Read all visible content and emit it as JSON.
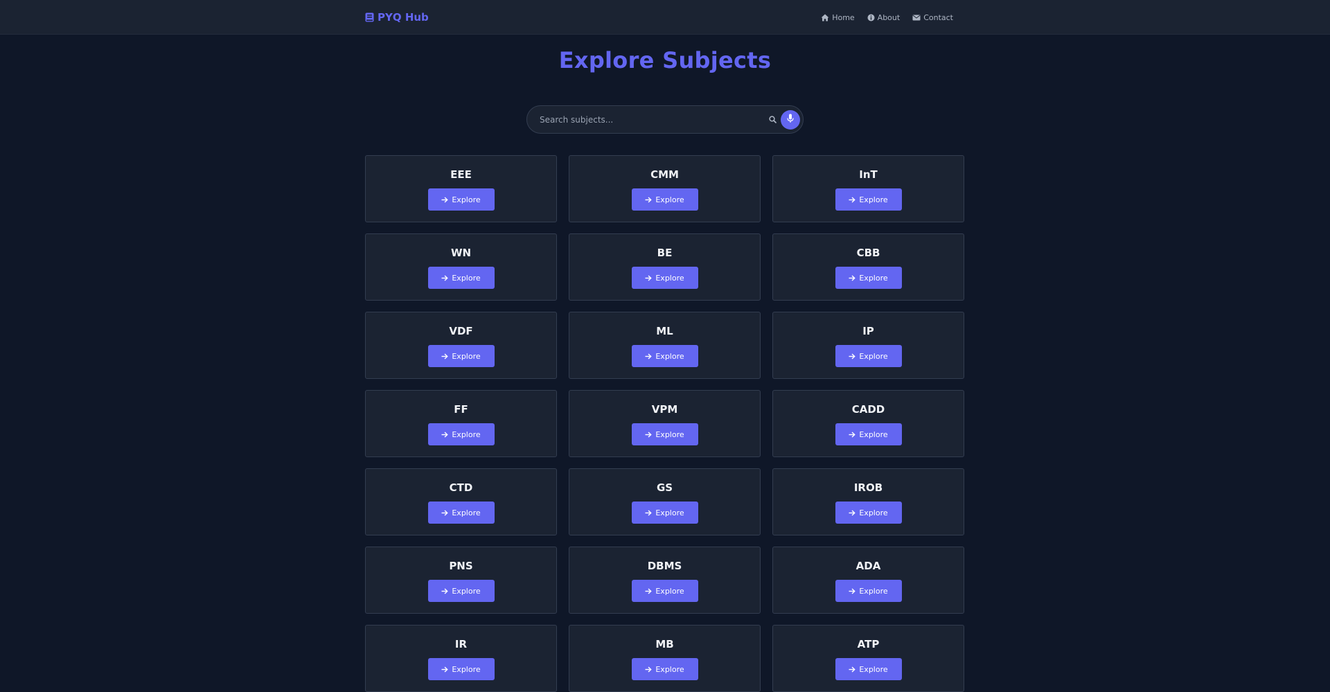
{
  "nav": {
    "brand": "PYQ Hub",
    "brand_icon": "book-icon",
    "links": [
      {
        "label": "Home",
        "icon": "home-icon"
      },
      {
        "label": "About",
        "icon": "info-circle-icon"
      },
      {
        "label": "Contact",
        "icon": "envelope-icon"
      }
    ]
  },
  "page": {
    "title": "Explore Subjects"
  },
  "search": {
    "placeholder": "Search subjects...",
    "value": "",
    "search_icon": "search-icon",
    "mic_icon": "microphone-icon"
  },
  "subjects": {
    "button_label": "Explore",
    "button_icon": "arrow-right-icon",
    "items": [
      "EEE",
      "CMM",
      "InT",
      "WN",
      "BE",
      "CBB",
      "VDF",
      "ML",
      "IP",
      "FF",
      "VPM",
      "CADD",
      "CTD",
      "GS",
      "IROB",
      "PNS",
      "DBMS",
      "ADA",
      "IR",
      "MB",
      "ATP"
    ]
  },
  "colors": {
    "accent": "#6366f1",
    "background": "#0f1728",
    "surface": "#1b2332",
    "border": "#333d50"
  }
}
